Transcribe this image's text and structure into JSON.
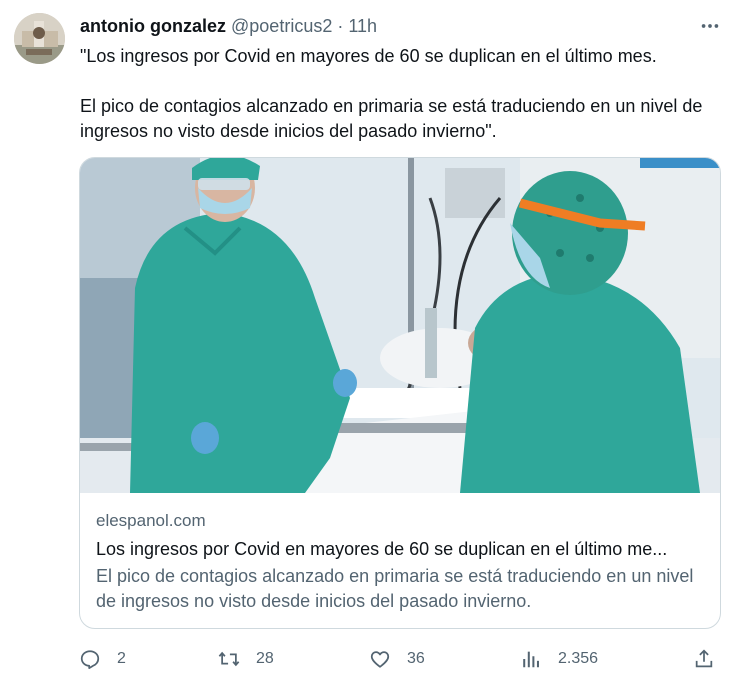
{
  "author": {
    "name": "antonio gonzalez",
    "handle": "@poetricus2",
    "separator": "·",
    "time": "11h"
  },
  "tweet": {
    "paragraph1": "\"Los ingresos por Covid en mayores de 60 se duplican en el último mes.",
    "paragraph2": "El pico de contagios alcanzado en primaria se está traduciendo en un nivel de ingresos no visto desde inicios del pasado invierno\"."
  },
  "card": {
    "domain": "elespanol.com",
    "title": "Los ingresos por Covid en mayores de 60 se duplican en el último me...",
    "description": "El pico de contagios alcanzado en primaria se está traduciendo en un nivel de ingresos no visto desde inicios del pasado invierno."
  },
  "actions": {
    "replies": "2",
    "retweets": "28",
    "likes": "36",
    "views": "2.356"
  },
  "icons": {
    "more": "more-horizontal-icon",
    "reply": "reply-icon",
    "retweet": "retweet-icon",
    "like": "heart-icon",
    "views": "views-chart-icon",
    "share": "share-icon"
  },
  "colors": {
    "text": "#0f1419",
    "secondary": "#536471",
    "border": "#cfd9de",
    "scrub": "#2fa79a"
  }
}
